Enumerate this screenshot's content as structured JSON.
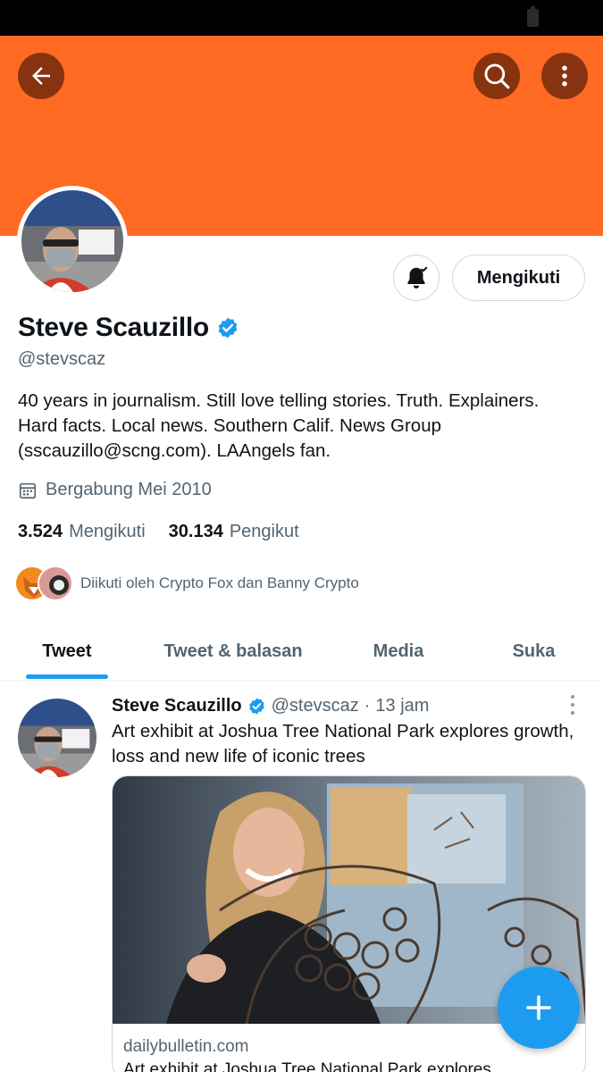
{
  "colors": {
    "banner": "#ff6a22",
    "accent": "#1d9bf0",
    "text_primary": "#0f1419",
    "text_secondary": "#536471"
  },
  "header": {
    "back_icon": "arrow-left-icon",
    "search_icon": "search-icon",
    "more_icon": "more-vertical-icon"
  },
  "profile": {
    "notifications_icon": "bell-check-icon",
    "follow_button_label": "Mengikuti",
    "display_name": "Steve Scauzillo",
    "verified_icon": "verified-badge-icon",
    "handle": "@stevscaz",
    "bio": "40 years in journalism. Still love telling stories. Truth. Explainers. Hard facts. Local news. Southern Calif. News Group (sscauzillo@scng.com). LAAngels fan.",
    "joined_icon": "calendar-icon",
    "joined": "Bergabung Mei 2010",
    "following_count": "3.524",
    "following_label": "Mengikuti",
    "followers_count": "30.134",
    "followers_label": "Pengikut",
    "followed_by": "Diikuti oleh Crypto Fox dan Banny Crypto"
  },
  "tabs": [
    {
      "label": "Tweet",
      "active": true
    },
    {
      "label": "Tweet & balasan",
      "active": false
    },
    {
      "label": "Media",
      "active": false
    },
    {
      "label": "Suka",
      "active": false
    }
  ],
  "tweet": {
    "name": "Steve Scauzillo",
    "handle": "@stevscaz",
    "separator": "·",
    "time": "13 jam",
    "text": "Art exhibit at Joshua Tree National Park explores growth, loss and new life of iconic trees",
    "card_domain": "dailybulletin.com",
    "card_title": "Art exhibit at Joshua Tree National Park explores"
  },
  "fab": {
    "icon": "plus-icon"
  }
}
